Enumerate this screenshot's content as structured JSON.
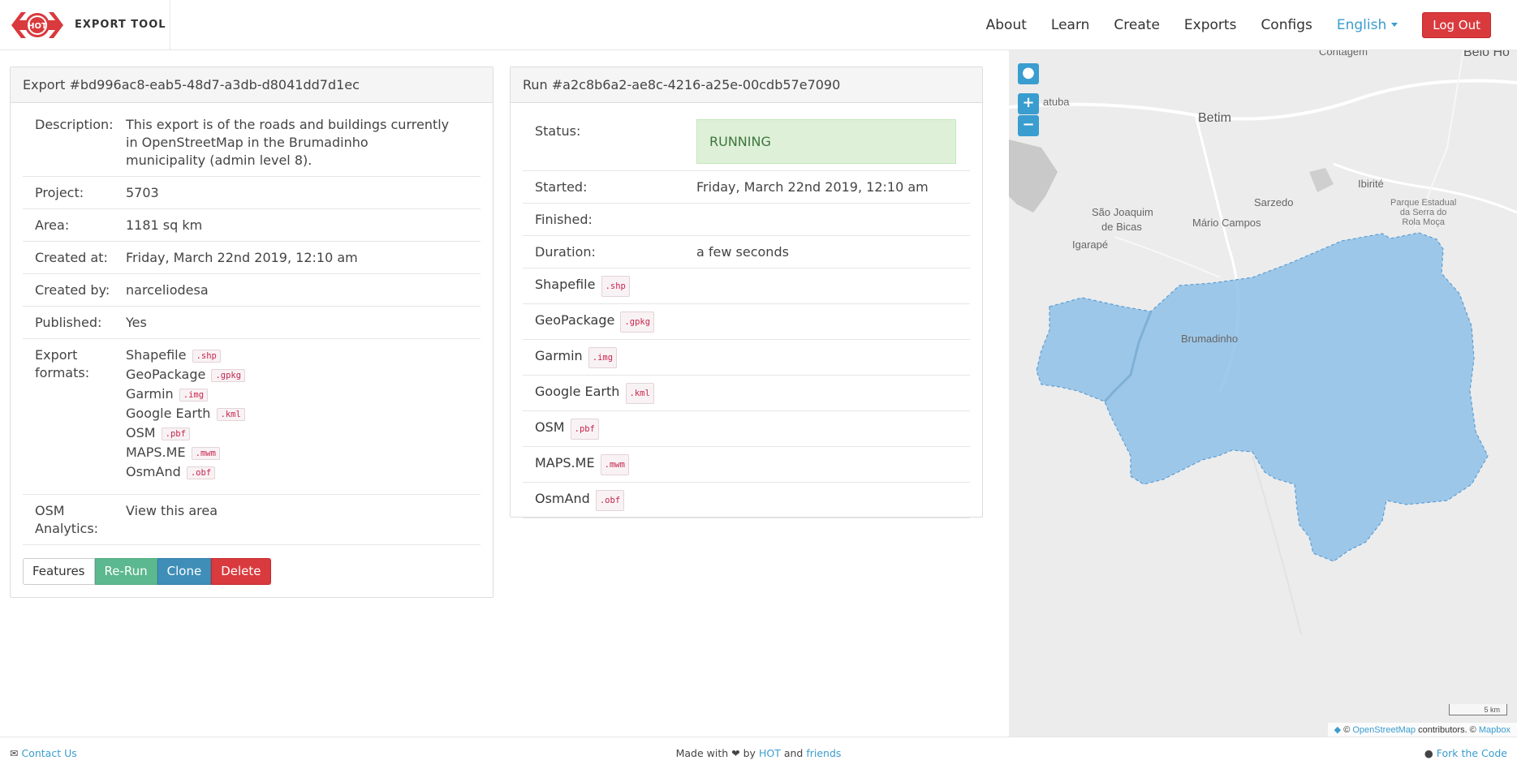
{
  "nav": {
    "brand_logo_text": "HOT",
    "brand_title": "EXPORT TOOL",
    "links": [
      "About",
      "Learn",
      "Create",
      "Exports",
      "Configs"
    ],
    "language": "English",
    "logout": "Log Out"
  },
  "export_panel": {
    "title": "Export #bd996ac8-eab5-48d7-a3db-d8041dd7d1ec",
    "description_label": "Description:",
    "description": "This export is of the roads and buildings currently in OpenStreetMap in the Brumadinho municipality (admin level 8).",
    "project_label": "Project:",
    "project": "5703",
    "area_label": "Area:",
    "area": "1181 sq km",
    "created_at_label": "Created at:",
    "created_at": "Friday, March 22nd 2019, 12:10 am",
    "created_by_label": "Created by:",
    "created_by": "narceliodesa",
    "published_label": "Published:",
    "published": "Yes",
    "formats_label": "Export formats:",
    "formats": [
      {
        "name": "Shapefile",
        "ext": ".shp"
      },
      {
        "name": "GeoPackage",
        "ext": ".gpkg"
      },
      {
        "name": "Garmin",
        "ext": ".img"
      },
      {
        "name": "Google Earth",
        "ext": ".kml"
      },
      {
        "name": "OSM",
        "ext": ".pbf"
      },
      {
        "name": "MAPS.ME",
        "ext": ".mwm"
      },
      {
        "name": "OsmAnd",
        "ext": ".obf"
      }
    ],
    "analytics_label": "OSM Analytics:",
    "analytics_link": "View this area",
    "buttons": {
      "features": "Features",
      "rerun": "Re-Run",
      "clone": "Clone",
      "delete": "Delete"
    }
  },
  "run_panel": {
    "title": "Run #a2c8b6a2-ae8c-4216-a25e-00cdb57e7090",
    "status_label": "Status:",
    "status": "RUNNING",
    "started_label": "Started:",
    "started": "Friday, March 22nd 2019, 12:10 am",
    "finished_label": "Finished:",
    "finished": "",
    "duration_label": "Duration:",
    "duration": "a few seconds",
    "files": [
      {
        "name": "Shapefile",
        "ext": ".shp"
      },
      {
        "name": "GeoPackage",
        "ext": ".gpkg"
      },
      {
        "name": "Garmin",
        "ext": ".img"
      },
      {
        "name": "Google Earth",
        "ext": ".kml"
      },
      {
        "name": "OSM",
        "ext": ".pbf"
      },
      {
        "name": "MAPS.ME",
        "ext": ".mwm"
      },
      {
        "name": "OsmAnd",
        "ext": ".obf"
      }
    ]
  },
  "map": {
    "places": {
      "contagem": "Contagem",
      "belo_horizonte": "Belo Ho",
      "betim": "Betim",
      "ibirite": "Ibirité",
      "sarzedo": "Sarzedo",
      "sao_joaquim_1": "São Joaquim",
      "sao_joaquim_2": "de Bicas",
      "mario_campos": "Mário Campos",
      "igarape": "Igarapé",
      "brumadinho": "Brumadinho",
      "parque_1": "Parque Estadual",
      "parque_2": "da Serra do",
      "parque_3": "Rola Moça",
      "atuba": "atuba"
    },
    "zoom_in": "+",
    "zoom_out": "−",
    "scale": "5 km",
    "attribution_prefix": "©",
    "attribution_osm": "OpenStreetMap",
    "attribution_mid": "contributors. ©",
    "attribution_mapbox": "Mapbox",
    "area_color": "#8fc1e8"
  },
  "footer": {
    "contact": "Contact Us",
    "made_with": "Made with",
    "heart": "❤",
    "by": "by",
    "hot": "HOT",
    "and": "and",
    "friends": "friends",
    "fork": "Fork the Code"
  }
}
